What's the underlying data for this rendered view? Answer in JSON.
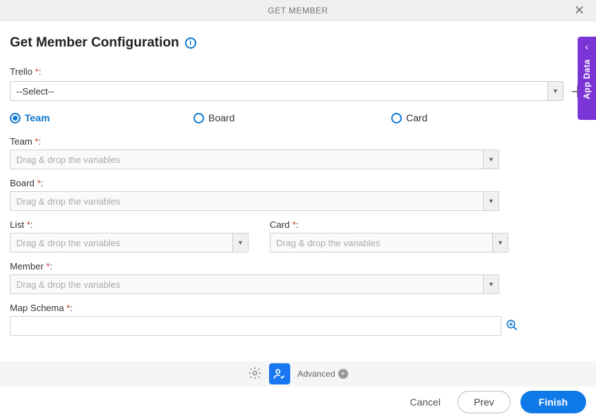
{
  "header": {
    "title": "GET MEMBER"
  },
  "page": {
    "title": "Get Member Configuration"
  },
  "trello": {
    "label": "Trello",
    "placeholder": "--Select--"
  },
  "radios": {
    "team": "Team",
    "board": "Board",
    "card": "Card",
    "selected": "team"
  },
  "fields": {
    "team": {
      "label": "Team",
      "placeholder": "Drag & drop the variables"
    },
    "board": {
      "label": "Board",
      "placeholder": "Drag & drop the variables"
    },
    "list": {
      "label": "List",
      "placeholder": "Drag & drop the variables"
    },
    "card": {
      "label": "Card",
      "placeholder": "Drag & drop the variables"
    },
    "member": {
      "label": "Member",
      "placeholder": "Drag & drop the variables"
    },
    "schema": {
      "label": "Map Schema"
    }
  },
  "toolbar": {
    "advanced": "Advanced"
  },
  "buttons": {
    "cancel": "Cancel",
    "prev": "Prev",
    "finish": "Finish"
  },
  "sideTab": {
    "label": "App Data"
  }
}
